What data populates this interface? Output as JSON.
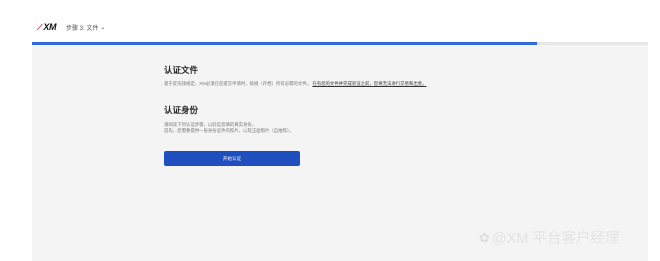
{
  "header": {
    "logo_text": "XM",
    "step_label": "步骤 3: 文件",
    "step_chevron": "⌄"
  },
  "progress": {
    "fraction": 0.82
  },
  "documents_section": {
    "title": "认证文件",
    "intro": "基于反洗钱规定，XM必须在您提交申请时，按规（存档）所有必需的文件。",
    "intro_link": "在有您的文件并完成验证之前，您将无法进行交易和出金。"
  },
  "identity_section": {
    "title": "认证身份",
    "line1": "请阅读下列认证步骤，以验证您填的真实身份。",
    "line2": "首先，您需要提供一张身份证件的照片，以及正面照片（自拍照）。"
  },
  "start_button": {
    "label": "开始认证"
  },
  "watermark": {
    "icon": "✿",
    "text": "@XM 平台客户经理"
  },
  "colors": {
    "accent": "#2f6bd7",
    "button": "#1f4fbf",
    "main_bg": "#f4f4f4"
  }
}
